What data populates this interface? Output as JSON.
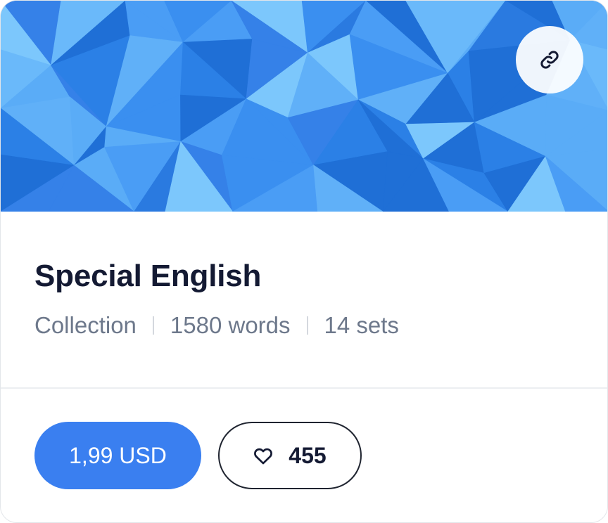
{
  "card": {
    "title": "Special English",
    "meta": {
      "type": "Collection",
      "words": "1580 words",
      "sets": "14 sets"
    }
  },
  "cover": {
    "icon": "link-icon",
    "palette": [
      "#1f6fd6",
      "#2b80e6",
      "#3a8ff0",
      "#4a9df5",
      "#5aacf7",
      "#6ab9fa",
      "#7cc7fc",
      "#3581e8",
      "#60b0f8",
      "#2a7ae0"
    ]
  },
  "footer": {
    "price_label": "1,99 USD",
    "likes_count": "455",
    "like_icon": "heart-icon"
  },
  "colors": {
    "accent": "#3a7ff0",
    "title": "#141a33",
    "meta": "#6d788b"
  }
}
